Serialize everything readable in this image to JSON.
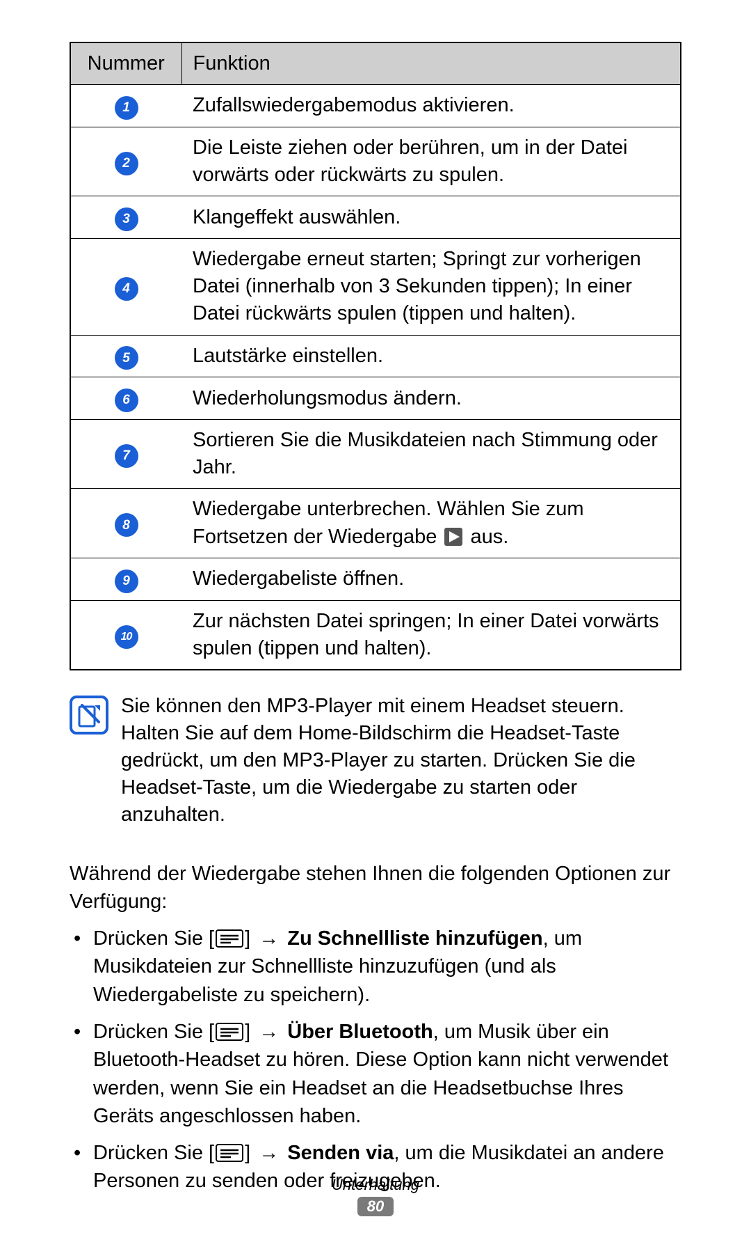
{
  "table": {
    "headers": {
      "num": "Nummer",
      "func": "Funktion"
    },
    "rows": [
      {
        "n": "1",
        "text": "Zufallswiedergabemodus aktivieren."
      },
      {
        "n": "2",
        "text": "Die Leiste ziehen oder berühren, um in der Datei vorwärts oder rückwärts zu spulen."
      },
      {
        "n": "3",
        "text": "Klangeffekt auswählen."
      },
      {
        "n": "4",
        "text": "Wiedergabe erneut starten; Springt zur vorherigen Datei (innerhalb von 3 Sekunden tippen); In einer Datei rückwärts spulen (tippen und halten)."
      },
      {
        "n": "5",
        "text": "Lautstärke einstellen."
      },
      {
        "n": "6",
        "text": "Wiederholungsmodus ändern."
      },
      {
        "n": "7",
        "text": "Sortieren Sie die Musikdateien nach Stimmung oder Jahr."
      },
      {
        "n": "8",
        "pre": "Wiedergabe unterbrechen. Wählen Sie zum Fortsetzen der Wiedergabe ",
        "post": " aus."
      },
      {
        "n": "9",
        "text": "Wiedergabeliste öffnen."
      },
      {
        "n": "10",
        "text": "Zur nächsten Datei springen; In einer Datei vorwärts spulen (tippen und halten)."
      }
    ]
  },
  "note": {
    "text": "Sie können den MP3-Player mit einem Headset steuern. Halten Sie auf dem Home-Bildschirm die Headset-Taste gedrückt, um den MP3-Player zu starten. Drücken Sie die Headset-Taste, um die Wiedergabe zu starten oder anzuhalten."
  },
  "intro": "Während der Wiedergabe stehen Ihnen die folgenden Optionen zur Verfügung:",
  "bullets": [
    {
      "pre": "Drücken Sie [",
      "arrow": " → ",
      "bold": "Zu Schnellliste hinzufügen",
      "post": ", um Musikdateien zur Schnellliste hinzuzufügen (und als Wiedergabeliste zu speichern)."
    },
    {
      "pre": "Drücken Sie [",
      "arrow": " → ",
      "bold": "Über Bluetooth",
      "post": ", um Musik über ein Bluetooth-Headset zu hören. Diese Option kann nicht verwendet werden, wenn Sie ein Headset an die Headsetbuchse Ihres Geräts angeschlossen haben."
    },
    {
      "pre": "Drücken Sie [",
      "arrow": " → ",
      "bold": "Senden via",
      "post": ", um die Musikdatei an andere Personen zu senden oder freizugeben."
    }
  ],
  "bracket_close": "]",
  "footer": {
    "section": "Unterhaltung",
    "page": "80"
  }
}
